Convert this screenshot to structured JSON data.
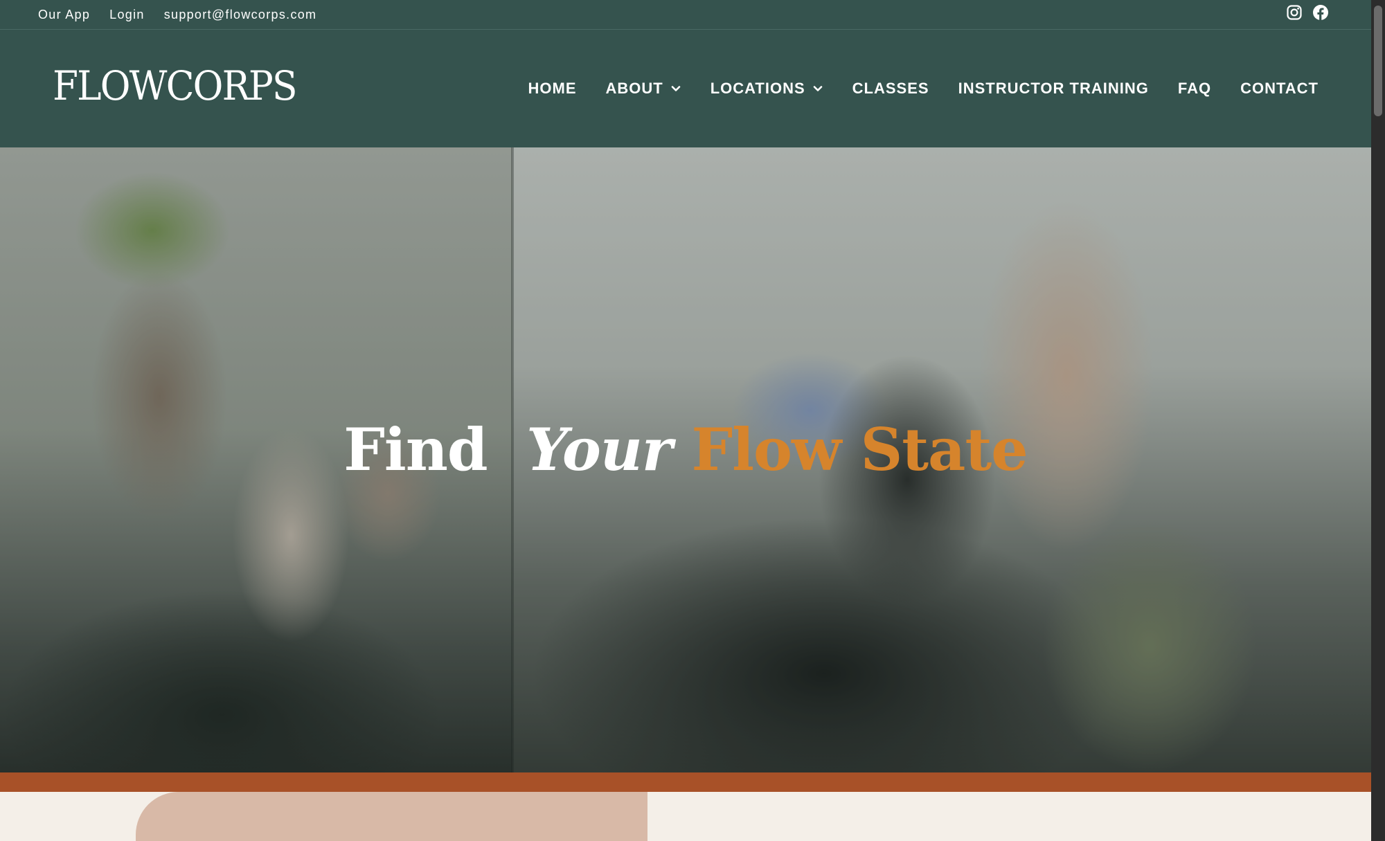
{
  "topbar": {
    "links": [
      "Our App",
      "Login",
      "support@flowcorps.com"
    ],
    "social": [
      {
        "icon": "instagram-icon"
      },
      {
        "icon": "facebook-icon"
      }
    ]
  },
  "header": {
    "logo": "FLOWCORPS",
    "nav": [
      {
        "label": "HOME",
        "dropdown": false
      },
      {
        "label": "ABOUT",
        "dropdown": true
      },
      {
        "label": "LOCATIONS",
        "dropdown": true
      },
      {
        "label": "CLASSES",
        "dropdown": false
      },
      {
        "label": "INSTRUCTOR TRAINING",
        "dropdown": false
      },
      {
        "label": "FAQ",
        "dropdown": false
      },
      {
        "label": "CONTACT",
        "dropdown": false
      }
    ]
  },
  "hero": {
    "title_word1": "Find",
    "title_word2": "Your",
    "title_word3": "Flow State"
  },
  "colors": {
    "header_bg": "#35534e",
    "accent_orange": "#d6842c",
    "band": "#a85128",
    "page_bg": "#f4efe8",
    "card": "#d8b9a7"
  }
}
